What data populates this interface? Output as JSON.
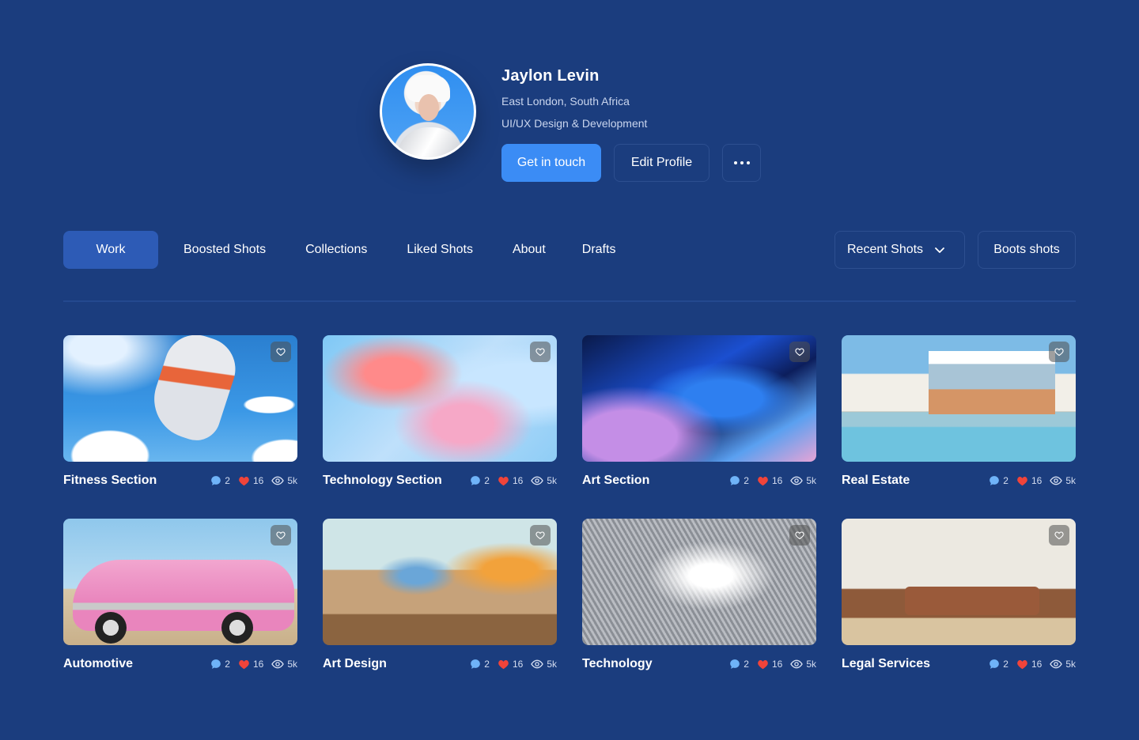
{
  "profile": {
    "name": "Jaylon Levin",
    "location": "East London, South Africa",
    "role": "UI/UX Design & Development",
    "primary_label": "Get in touch",
    "edit_label": "Edit Profile"
  },
  "tabs": [
    {
      "label": "Work",
      "active": true
    },
    {
      "label": "Boosted Shots"
    },
    {
      "label": "Collections"
    },
    {
      "label": "Liked Shots"
    },
    {
      "label": "About"
    },
    {
      "label": "Drafts"
    }
  ],
  "controls": {
    "sort_label": "Recent Shots",
    "boost_label": "Boots shots"
  },
  "shots": [
    {
      "title": "Fitness Section",
      "comments": "2",
      "likes": "16",
      "views": "5k"
    },
    {
      "title": "Technology Section",
      "comments": "2",
      "likes": "16",
      "views": "5k"
    },
    {
      "title": "Art Section",
      "comments": "2",
      "likes": "16",
      "views": "5k"
    },
    {
      "title": "Real Estate",
      "comments": "2",
      "likes": "16",
      "views": "5k"
    },
    {
      "title": "Automotive",
      "comments": "2",
      "likes": "16",
      "views": "5k"
    },
    {
      "title": "Art Design",
      "comments": "2",
      "likes": "16",
      "views": "5k"
    },
    {
      "title": "Technology",
      "comments": "2",
      "likes": "16",
      "views": "5k"
    },
    {
      "title": "Legal Services",
      "comments": "2",
      "likes": "16",
      "views": "5k"
    }
  ],
  "colors": {
    "background": "#1b3d7e",
    "accent": "#3b8cf5",
    "active_tab": "#2d5bb6",
    "heart": "#f0443a"
  }
}
